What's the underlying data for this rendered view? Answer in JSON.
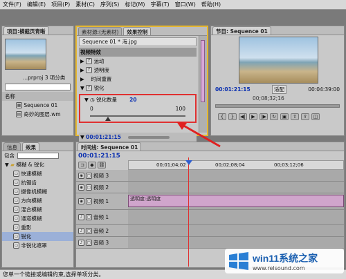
{
  "menu": [
    "文件(F)",
    "编辑(E)",
    "项目(P)",
    "素材(C)",
    "序列(S)",
    "标记(M)",
    "字幕(T)",
    "窗口(W)",
    "帮助(H)"
  ],
  "project": {
    "tab": "项目:横截页青晰",
    "filename": "...prproj",
    "count": "3 项分类",
    "name_header": "名称",
    "items": [
      "Sequence 01",
      "奇妙的图层.wm"
    ]
  },
  "effect_control": {
    "tab_source": "素材源:(无素材)",
    "tab_effect": "效果控制",
    "clip_title": "Sequence 01 * 海.jpg",
    "section": "视频特效",
    "rows": [
      "运动",
      "透明度",
      "时间重置",
      "锐化"
    ],
    "param_label": "锐化数量",
    "param_value": "20",
    "slider_min": "0",
    "slider_max": "100",
    "slider_level": 0.2,
    "timecode": "00:01:21:15"
  },
  "program": {
    "tab": "节目: Sequence 01",
    "timecode": "00:01:21:15",
    "fit": "适配",
    "duration": "00:04:39:00",
    "ruler_time": "00;08;32;16"
  },
  "effects_panel": {
    "tab_info": "信息",
    "tab_effects": "效果",
    "contains": "包含",
    "folder": "模糊 & 锐化",
    "items": [
      "快速模糊",
      "抗锯齿",
      "摄像机模糊",
      "方向模糊",
      "混合模糊",
      "通道模糊",
      "重影",
      "锐化",
      "非锐化遮罩"
    ],
    "selected": 7
  },
  "timeline": {
    "tab": "时间线: Sequence 01",
    "timecode": "00:01:21:15",
    "ruler": [
      "00;01;04;02",
      "00;02;08;04",
      "00;03;12;06"
    ],
    "tracks": [
      "视频 3",
      "视频 2",
      "视频 1",
      "音频 1",
      "音频 2",
      "音频 3"
    ],
    "clip_label": "透明度:透明度"
  },
  "status": "您单一个链接或编辑约束,选择单项分类。",
  "watermark": {
    "title": "win11系统之家",
    "url": "www.relsound.com"
  }
}
